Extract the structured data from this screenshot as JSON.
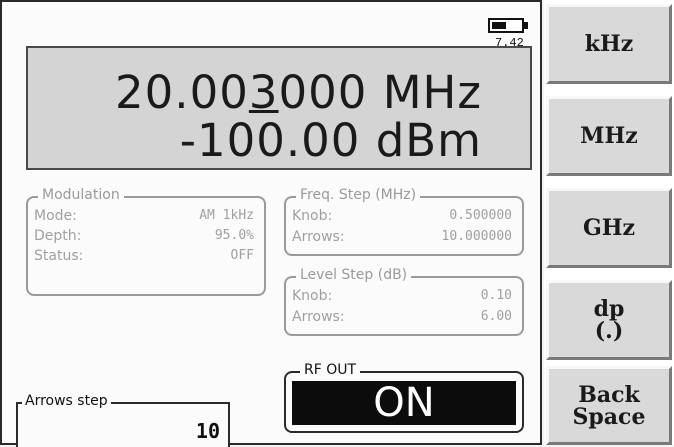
{
  "battery": {
    "label": "7.42",
    "level": 0.5
  },
  "display": {
    "freq_pre": "20.00",
    "freq_cursor": "3",
    "freq_post": "000 MHz",
    "level": "-100.00 dBm"
  },
  "modulation": {
    "title": "Modulation",
    "rows": [
      {
        "k": "Mode:",
        "v": "AM 1kHz"
      },
      {
        "k": "Depth:",
        "v": "95.0%"
      },
      {
        "k": "Status:",
        "v": "OFF"
      }
    ]
  },
  "freq_step": {
    "title": "Freq. Step (MHz)",
    "rows": [
      {
        "k": "Knob:",
        "v": "0.500000"
      },
      {
        "k": "Arrows:",
        "v": "10.000000"
      }
    ]
  },
  "level_step": {
    "title": "Level Step (dB)",
    "rows": [
      {
        "k": "Knob:",
        "v": "0.10"
      },
      {
        "k": "Arrows:",
        "v": "6.00"
      }
    ]
  },
  "rf_out": {
    "title": "RF OUT",
    "state": "ON"
  },
  "arrows_step": {
    "title": "Arrows step",
    "value": "10"
  },
  "softkeys": [
    "kHz",
    "MHz",
    "GHz",
    "dp\n(.)",
    "Back\nSpace"
  ]
}
